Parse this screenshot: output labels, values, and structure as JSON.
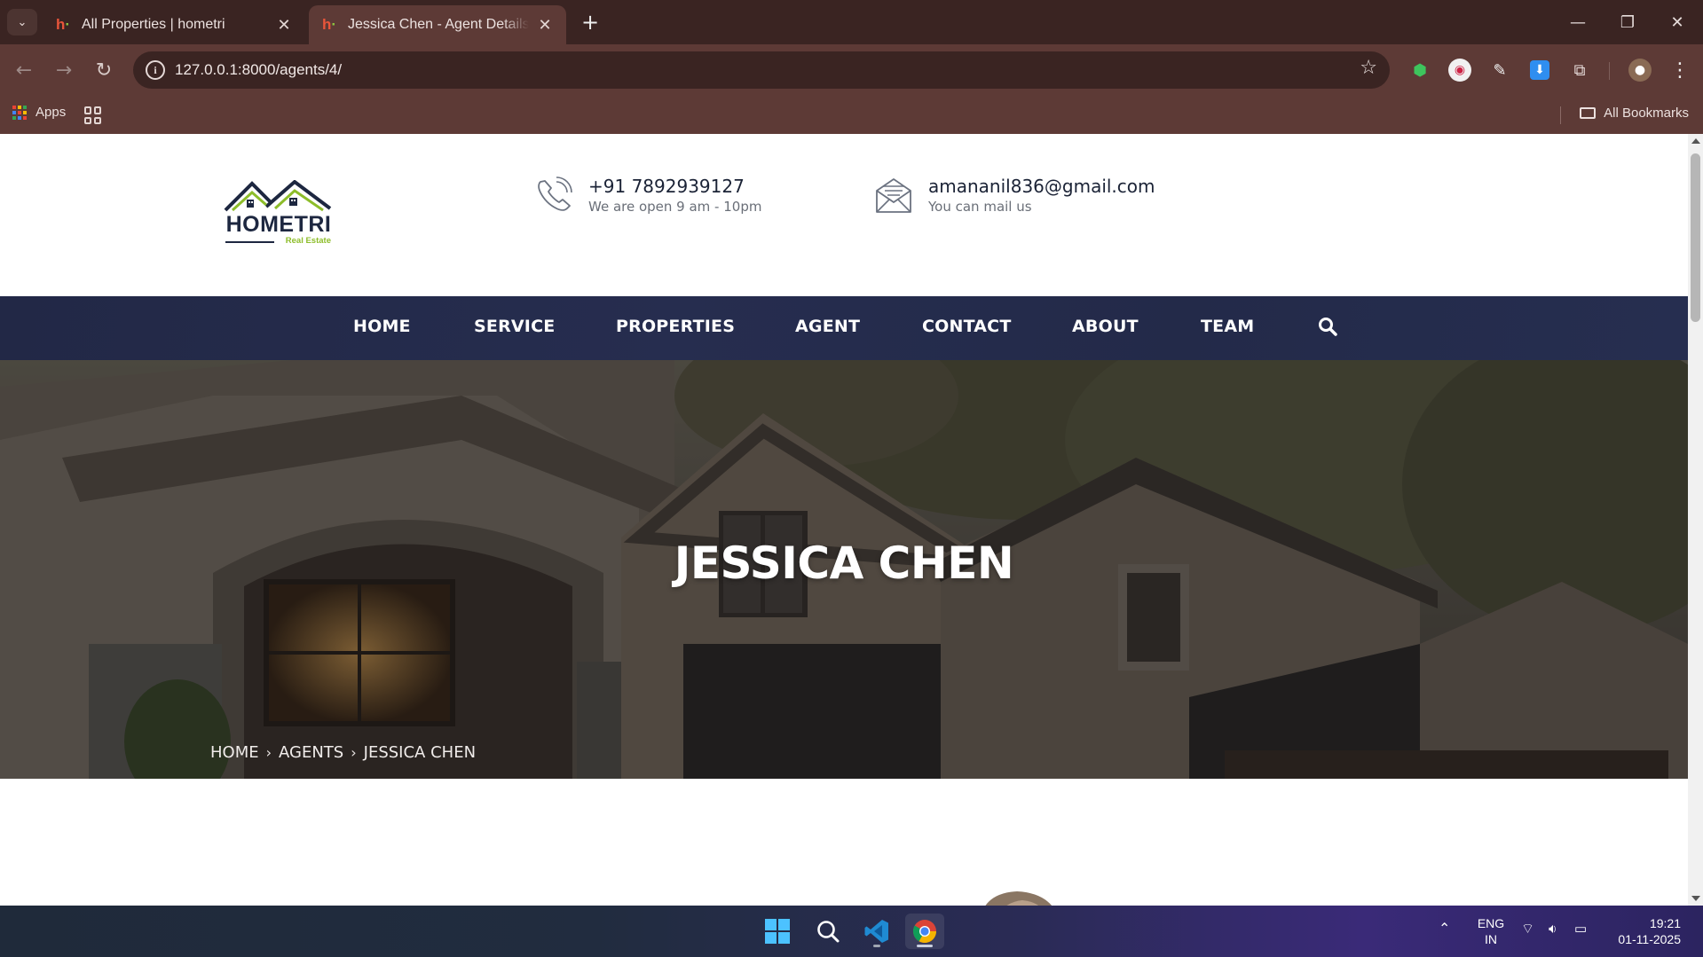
{
  "browser": {
    "tabs": [
      {
        "title": "All Properties | hometri",
        "active": false
      },
      {
        "title": "Jessica Chen - Agent Details | hometri",
        "active": true
      }
    ],
    "url": "127.0.0.1:8000/agents/4/",
    "bookmarks": {
      "apps_label": "Apps",
      "all_bookmarks_label": "All Bookmarks"
    },
    "colors": {
      "frame": "#3a2422",
      "toolbar": "#5d3a36"
    }
  },
  "header": {
    "logo": {
      "word": "HOMETRI",
      "tagline": "Real Estate"
    },
    "phone": {
      "number": "+91 7892939127",
      "hours": "We are open 9 am - 10pm"
    },
    "email": {
      "address": "amananil836@gmail.com",
      "note": "You can mail us"
    }
  },
  "nav": {
    "items": [
      "HOME",
      "SERVICE",
      "PROPERTIES",
      "AGENT",
      "CONTACT",
      "ABOUT",
      "TEAM"
    ],
    "search_icon": "search-icon",
    "bg_color": "#242b4b"
  },
  "hero": {
    "title": "JESSICA CHEN",
    "breadcrumb": [
      "HOME",
      "AGENTS",
      "JESSICA CHEN"
    ]
  },
  "taskbar": {
    "apps": [
      "windows-start-icon",
      "search-icon",
      "vscode-icon",
      "chrome-icon"
    ],
    "language": {
      "line1": "ENG",
      "line2": "IN"
    },
    "time": "19:21",
    "date": "01-11-2025"
  }
}
